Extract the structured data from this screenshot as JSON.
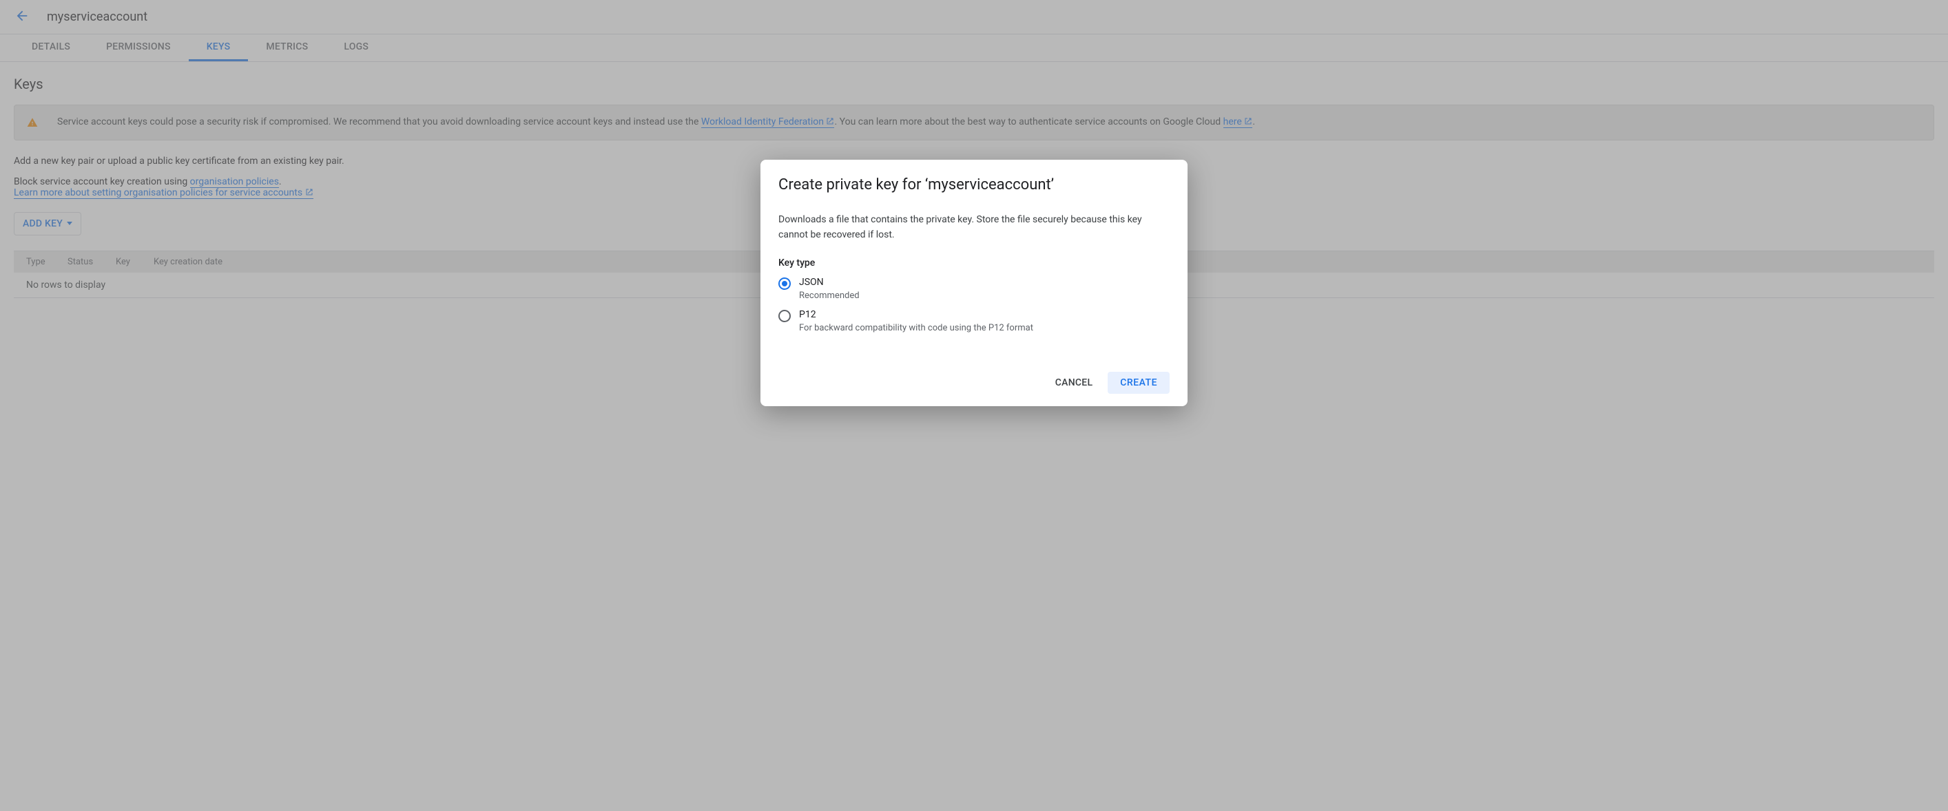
{
  "header": {
    "title": "myserviceaccount"
  },
  "tabs": {
    "items": [
      {
        "label": "DETAILS"
      },
      {
        "label": "PERMISSIONS"
      },
      {
        "label": "KEYS"
      },
      {
        "label": "METRICS"
      },
      {
        "label": "LOGS"
      }
    ],
    "active_index": 2
  },
  "main": {
    "heading": "Keys",
    "warning": {
      "prefix": "Service account keys could pose a security risk if compromised. We recommend that you avoid downloading service account keys and instead use the ",
      "link1": "Workload Identity Federation",
      "middle": ". You can learn more about the best way to authenticate service accounts on Google Cloud ",
      "link2": "here",
      "suffix": "."
    },
    "add_text": "Add a new key pair or upload a public key certificate from an existing key pair.",
    "block_prefix": "Block service account key creation using ",
    "block_link": "organisation policies",
    "block_suffix": ".",
    "learn_link": "Learn more about setting organisation policies for service accounts",
    "add_key_button": "ADD KEY",
    "table": {
      "columns": {
        "type": "Type",
        "status": "Status",
        "key": "Key",
        "created": "Key creation date"
      },
      "empty": "No rows to display"
    }
  },
  "dialog": {
    "title": "Create private key for ‘myserviceaccount’",
    "description": "Downloads a file that contains the private key. Store the file securely because this key cannot be recovered if lost.",
    "keytype_label": "Key type",
    "options": [
      {
        "label": "JSON",
        "sub": "Recommended",
        "selected": true
      },
      {
        "label": "P12",
        "sub": "For backward compatibility with code using the P12 format",
        "selected": false
      }
    ],
    "cancel": "CANCEL",
    "create": "CREATE"
  }
}
